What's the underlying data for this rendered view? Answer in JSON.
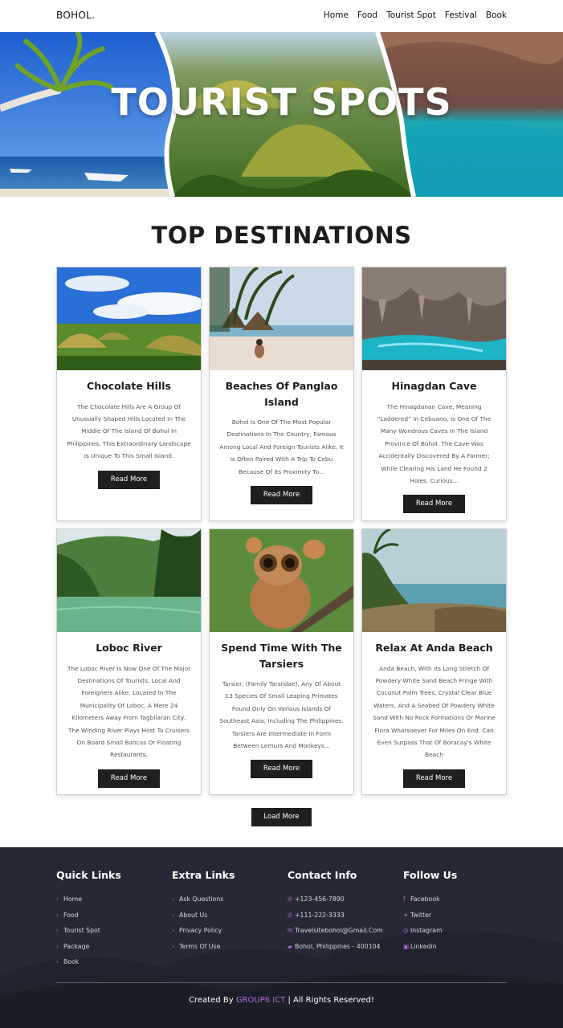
{
  "header": {
    "logo": "BOHOL.",
    "nav": [
      "Home",
      "Food",
      "Tourist Spot",
      "Festival",
      "Book"
    ]
  },
  "hero": {
    "title": "TOURIST SPOTS"
  },
  "section": {
    "title": "TOP DESTINATIONS"
  },
  "cards": [
    {
      "title": "Chocolate Hills",
      "description": "The Chocolate Hills Are A Group Of Unusually Shaped Hills Located In The Middle Of The Island Of Bohol In Philippines. This Extraordinary Landscape Is Unique To This Small Island.",
      "button": "Read More",
      "image": "chocolate-hills-photo"
    },
    {
      "title": "Beaches Of Panglao Island",
      "description": "Bohol Is One Of The Most Popular Destinations In The Country, Famous Among Local And Foreign Tourists Alike. It Is Often Paired With A Trip To Cebu Because Of Its Proximity To...",
      "button": "Read More",
      "image": "panglao-beach-photo"
    },
    {
      "title": "Hinagdan Cave",
      "description": "The Hinagdanan Cave, Meaning “Laddered” In Cebuano, Is One Of The Many Wondrous Caves In The Island Province Of Bohol. The Cave Was Accidentally Discovered By A Farmer; While Clearing His Land He Found 2 Holes, Curious...",
      "button": "Read More",
      "image": "cave-photo"
    },
    {
      "title": "Loboc River",
      "description": "The Loboc River Is Now One Of The Major Destinations Of Tourists, Local And Foreigners Alike. Located In The Municipality Of Loboc, A Mere 24 Kilometers Away From Tagbilaran City, The Winding River Plays Host To Cruisers On Board Small Bancas Or Floating Restaurants.",
      "button": "Read More",
      "image": "loboc-river-photo"
    },
    {
      "title": "Spend Time With The Tarsiers",
      "description": "Tarsier, (Family Tarsiidae), Any Of About 13 Species Of Small Leaping Primates Found Only On Various Islands Of Southeast Asia, Including The Philippines. Tarsiers Are Intermediate In Form Between Lemurs And Monkeys...",
      "button": "Read More",
      "image": "tarsier-photo"
    },
    {
      "title": "Relax At Anda Beach",
      "description": "Anda Beach, With Its Long Stretch Of Powdery White Sand Beach Fringe With Coconut Palm Trees, Crystal Clear Blue Waters, And A Seabed Of Powdery White Sand With No Rock Formations Or Marine Flora Whatsoever For Miles On End. Can Even Surpass That Of Boracay's White Beach",
      "button": "Read More",
      "image": "anda-beach-photo"
    }
  ],
  "load_more": "Load More",
  "footer": {
    "quick_links": {
      "title": "Quick Links",
      "items": [
        "Home",
        "Food",
        "Tourist Spot",
        "Package",
        "Book"
      ]
    },
    "extra_links": {
      "title": "Extra Links",
      "items": [
        "Ask Questions",
        "About Us",
        "Privacy Policy",
        "Terms Of Use"
      ]
    },
    "contact": {
      "title": "Contact Info",
      "items": [
        {
          "icon": "phone-icon",
          "text": "+123-456-7890"
        },
        {
          "icon": "phone-icon",
          "text": "+111-222-3333"
        },
        {
          "icon": "envelope-icon",
          "text": "Travelsitebohol@Gmail.Com"
        },
        {
          "icon": "map-icon",
          "text": "Bohol, Philippines - 400104"
        }
      ]
    },
    "follow": {
      "title": "Follow Us",
      "items": [
        {
          "icon": "facebook-icon",
          "text": "Facebook"
        },
        {
          "icon": "twitter-icon",
          "text": "Twitter"
        },
        {
          "icon": "instagram-icon",
          "text": "Instagram"
        },
        {
          "icon": "linkedin-icon",
          "text": "Linkedin"
        }
      ]
    },
    "credit": {
      "prefix": "Created By",
      "author": "GROUP6 ICT",
      "suffix": "| All Rights Reserved!"
    }
  },
  "colors": {
    "accent": "#b36cdb",
    "button": "#1f1f1f",
    "footer_bg": "#262935"
  }
}
